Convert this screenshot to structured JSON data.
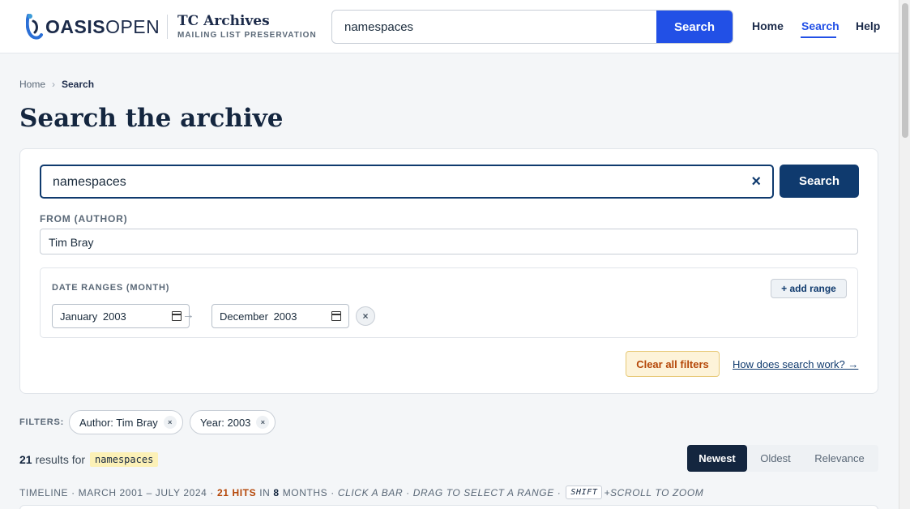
{
  "header": {
    "logo_bold": "OASIS",
    "logo_light": "OPEN",
    "brand_title": "TC Archives",
    "brand_subtitle": "MAILING LIST PRESERVATION",
    "search_value": "namespaces",
    "search_button": "Search",
    "nav": [
      {
        "label": "Home"
      },
      {
        "label": "Search",
        "active": true
      },
      {
        "label": "Help"
      }
    ]
  },
  "breadcrumb": {
    "home": "Home",
    "separator": "›",
    "current": "Search"
  },
  "page_title": "Search the archive",
  "search_panel": {
    "query_value": "namespaces",
    "clear_glyph": "×",
    "search_button": "Search",
    "author_label": "FROM (AUTHOR)",
    "author_value": "Tim Bray",
    "date_ranges_label": "DATE RANGES (MONTH)",
    "add_range": "+ add range",
    "range_from": "January 2003",
    "range_arrow": "→",
    "range_to": "December 2003",
    "range_remove": "×",
    "clear_all": "Clear all filters",
    "how_link": "How does search work? →"
  },
  "filters": {
    "label": "FILTERS:",
    "chips": [
      {
        "text": "Author: Tim Bray",
        "remove": "×"
      },
      {
        "text": "Year: 2003",
        "remove": "×"
      }
    ]
  },
  "results": {
    "count": "21",
    "results_for": "results for",
    "query": "namespaces",
    "sort": [
      {
        "label": "Newest",
        "active": true
      },
      {
        "label": "Oldest"
      },
      {
        "label": "Relevance"
      }
    ]
  },
  "timeline": {
    "prefix": "TIMELINE · MARCH 2001 – JULY 2024 ·",
    "hits": "21 HITS",
    "in": "IN",
    "months_count": "8",
    "months": "MONTHS ·",
    "hint": "CLICK A BAR · DRAG TO SELECT A RANGE ·",
    "kbd": "SHIFT",
    "zoom_hint": "+SCROLL TO ZOOM"
  },
  "colors": {
    "accent": "#2250e6",
    "navy": "#0f3a6e",
    "warning": "#b54708",
    "highlight": "#fcf1b7"
  }
}
